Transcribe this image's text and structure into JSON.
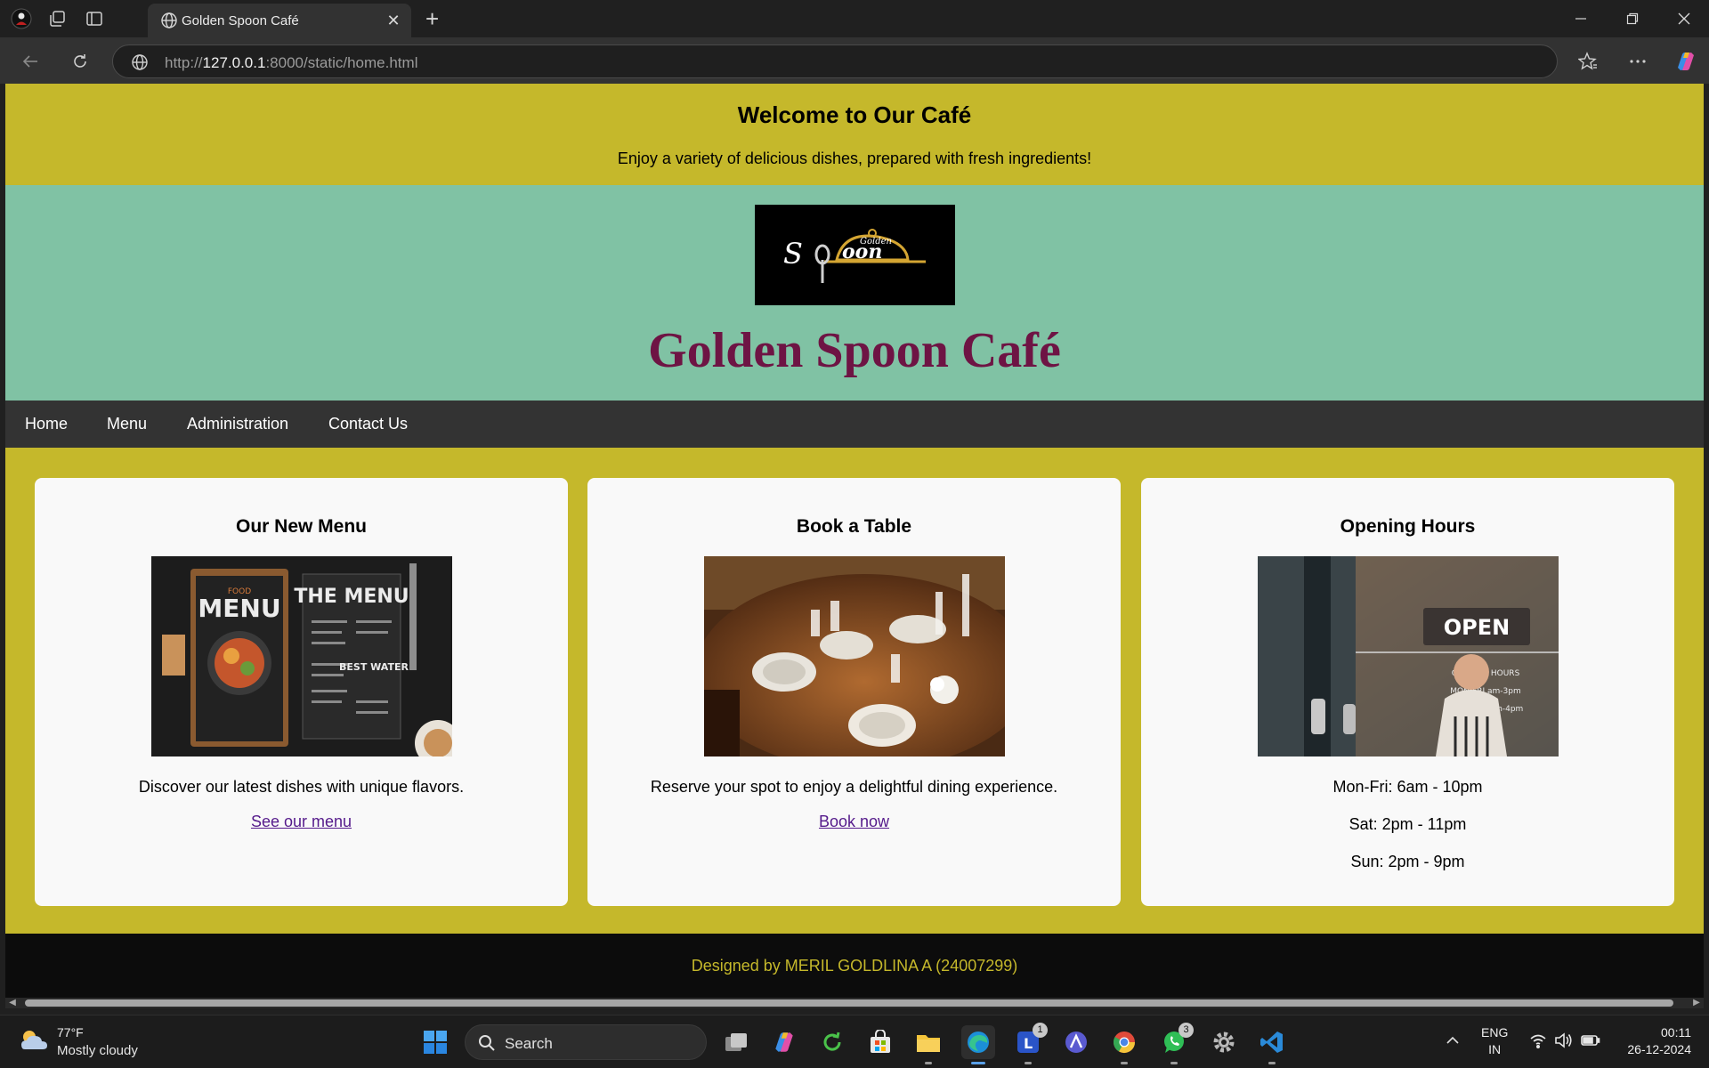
{
  "browser": {
    "tab_title": "Golden Spoon Café",
    "url_prefix": "http://",
    "url_host": "127.0.0.1",
    "url_rest": ":8000/static/home.html"
  },
  "page": {
    "welcome_title": "Welcome to Our Café",
    "welcome_text": "Enjoy a variety of delicious dishes, prepared with fresh ingredients!",
    "logo_text": "Golden Spoon",
    "brand_title": "Golden Spoon Café",
    "nav": [
      {
        "label": "Home"
      },
      {
        "label": "Menu"
      },
      {
        "label": "Administration"
      },
      {
        "label": "Contact Us"
      }
    ],
    "cards": [
      {
        "title": "Our New Menu",
        "image_alt": "Menu board with dishes",
        "desc": "Discover our latest dishes with unique flavors.",
        "link": "See our menu"
      },
      {
        "title": "Book a Table",
        "image_alt": "Set dining table",
        "desc": "Reserve your spot to enjoy a delightful dining experience.",
        "link": "Book now"
      },
      {
        "title": "Opening Hours",
        "image_alt": "Open sign on café door",
        "hours": [
          "Mon-Fri: 6am - 10pm",
          "Sat: 2pm - 11pm",
          "Sun: 2pm - 9pm"
        ]
      }
    ],
    "footer": "Designed by MERIL GOLDLINA A (24007299)",
    "menu_img_text": {
      "menu1": "MENU",
      "menu2": "THE MENU",
      "best": "BEST WATER",
      "food": "FOOD"
    },
    "open_img_text": {
      "open": "OPEN",
      "hours_label": "OPENING HOURS",
      "line1": "MON-FRI  am-3pm",
      "line2": "SAT-SUN  8am-4pm"
    }
  },
  "taskbar": {
    "weather_temp": "77°F",
    "weather_desc": "Mostly cloudy",
    "search_label": "Search",
    "badge_l": "1",
    "badge_whatsapp": "3",
    "lang_1": "ENG",
    "lang_2": "IN",
    "time": "00:11",
    "date": "26-12-2024"
  },
  "colors": {
    "mustard": "#c5b82b",
    "teal": "#80c2a4",
    "brand_title": "#6e1444",
    "navbar": "#333333",
    "footer": "#0c0c0c"
  }
}
